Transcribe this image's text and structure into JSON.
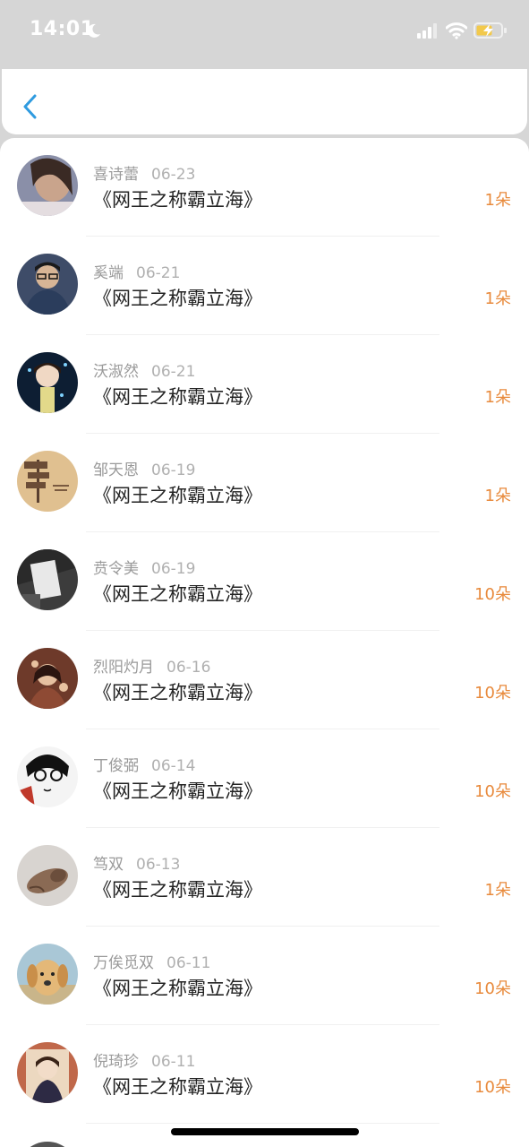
{
  "status_bar": {
    "time": "14:01"
  },
  "nav": {
    "back_icon": "chevron-left-icon"
  },
  "colors": {
    "accent": "#2f9be0",
    "count": "#e88a3c",
    "title": "#222222",
    "meta": "#9a9a9a"
  },
  "items": [
    {
      "name": "喜诗蕾",
      "date": "06-23",
      "title": "《网王之称霸立海》",
      "count": "1朵"
    },
    {
      "name": "奚端",
      "date": "06-21",
      "title": "《网王之称霸立海》",
      "count": "1朵"
    },
    {
      "name": "沃淑然",
      "date": "06-21",
      "title": "《网王之称霸立海》",
      "count": "1朵"
    },
    {
      "name": "邹天恩",
      "date": "06-19",
      "title": "《网王之称霸立海》",
      "count": "1朵"
    },
    {
      "name": "贲令美",
      "date": "06-19",
      "title": "《网王之称霸立海》",
      "count": "10朵"
    },
    {
      "name": "烈阳灼月",
      "date": "06-16",
      "title": "《网王之称霸立海》",
      "count": "10朵"
    },
    {
      "name": "丁俊弼",
      "date": "06-14",
      "title": "《网王之称霸立海》",
      "count": "10朵"
    },
    {
      "name": "笃双",
      "date": "06-13",
      "title": "《网王之称霸立海》",
      "count": "1朵"
    },
    {
      "name": "万俟觅双",
      "date": "06-11",
      "title": "《网王之称霸立海》",
      "count": "10朵"
    },
    {
      "name": "倪琦珍",
      "date": "06-11",
      "title": "《网王之称霸立海》",
      "count": "10朵"
    }
  ]
}
